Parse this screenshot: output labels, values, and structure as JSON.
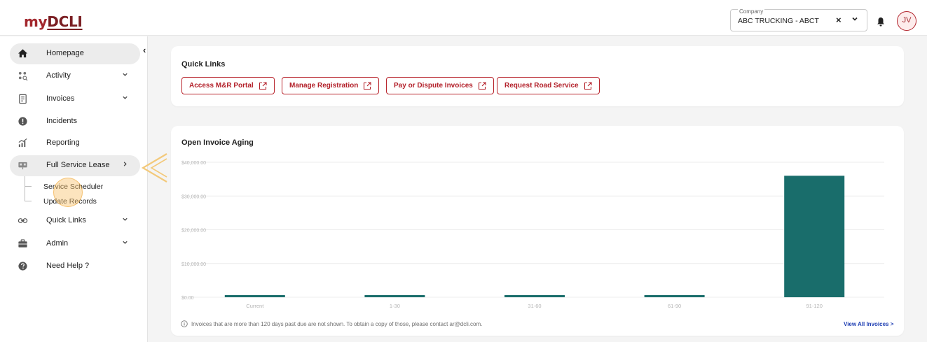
{
  "header": {
    "logo_prefix": "my",
    "logo_brand": "DCLI",
    "company_label": "Company",
    "company_value": "ABC TRUCKING - ABCT",
    "clear_symbol": "×",
    "avatar_initials": "JV"
  },
  "sidebar": {
    "collapse_symbol": "‹",
    "items": [
      {
        "label": "Homepage",
        "icon": "home-icon",
        "chevron": ""
      },
      {
        "label": "Activity",
        "icon": "activity-icon",
        "chevron": "⌄"
      },
      {
        "label": "Invoices",
        "icon": "invoice-icon",
        "chevron": "⌄"
      },
      {
        "label": "Incidents",
        "icon": "alert-icon",
        "chevron": ""
      },
      {
        "label": "Reporting",
        "icon": "reporting-icon",
        "chevron": ""
      },
      {
        "label": "Full Service Lease",
        "icon": "lease-icon",
        "chevron": "›"
      },
      {
        "label": "Quick Links",
        "icon": "link-icon",
        "chevron": "⌄"
      },
      {
        "label": "Admin",
        "icon": "briefcase-icon",
        "chevron": "⌄"
      },
      {
        "label": "Need Help ?",
        "icon": "help-icon",
        "chevron": ""
      }
    ],
    "sub_items": [
      "Service Scheduler",
      "Update Records"
    ]
  },
  "quick_links": {
    "title": "Quick Links",
    "buttons": [
      "Access M&R Portal",
      "Manage Registration",
      "Pay or Dispute Invoices",
      "Request Road Service"
    ]
  },
  "aging": {
    "title": "Open Invoice Aging",
    "footnote": "Invoices that are more than 120 days past due are not shown. To obtain a copy of those, please contact ar@dcli.com.",
    "view_all": "View All Invoices >"
  },
  "chart_data": {
    "type": "bar",
    "title": "Open Invoice Aging",
    "categories": [
      "Current",
      "1-30",
      "31-60",
      "61-90",
      "91-120"
    ],
    "values": [
      0,
      0,
      0,
      0,
      36000
    ],
    "y_ticks": [
      "$0.00",
      "$10,000.00",
      "$20,000.00",
      "$30,000.00",
      "$40,000.00"
    ],
    "ylim": [
      0,
      40000
    ],
    "bar_color": "#196d6b",
    "grid": true
  },
  "colors": {
    "brand_red": "#a3282e",
    "bar_teal": "#196d6b",
    "link_blue": "#1f3fb3"
  }
}
